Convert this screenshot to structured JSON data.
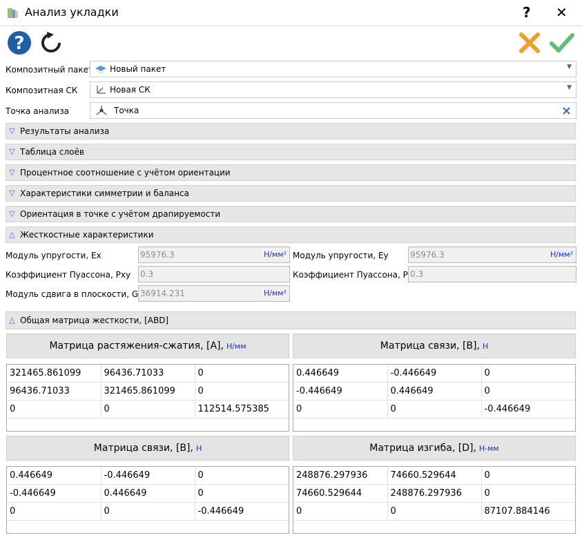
{
  "window": {
    "title": "Анализ укладки",
    "help_glyph": "?",
    "close_glyph": "✕"
  },
  "toolbar": {
    "help_icon": "help-circle-icon",
    "refresh_icon": "refresh-icon",
    "cancel_icon": "cancel-x-icon",
    "ok_icon": "ok-check-icon"
  },
  "colors": {
    "accent_blue": "#1a33c8",
    "help_blue": "#1d5fa8",
    "cancel_orange": "#f0a028",
    "ok_green": "#5fbf70"
  },
  "form": {
    "package": {
      "label": "Композитный пакет",
      "value": "Новый пакет"
    },
    "cs": {
      "label": "Композитная СК",
      "value": "Новая СК"
    },
    "point": {
      "label": "Точка анализа",
      "value": "Точка"
    }
  },
  "sections": [
    {
      "label": "Результаты анализа",
      "expanded": false
    },
    {
      "label": "Таблица слоёв",
      "expanded": false
    },
    {
      "label": "Процентное соотношение с учётом ориентации",
      "expanded": false
    },
    {
      "label": "Характеристики симметрии и баланса",
      "expanded": false
    },
    {
      "label": "Ориентация в точке с учётом драпируемости",
      "expanded": false
    },
    {
      "label": "Жесткостные характеристики",
      "expanded": true
    }
  ],
  "stiffness": {
    "ex": {
      "label": "Модуль упругости, Ex",
      "value": "95976.3",
      "unit": "Н/мм²"
    },
    "ey": {
      "label": "Модуль упругости, Ey",
      "value": "95976.3",
      "unit": "Н/мм²"
    },
    "pxy": {
      "label": "Коэффициент Пуассона, Pxy",
      "value": "0.3"
    },
    "pyx": {
      "label": "Коэффициент Пуассона, Pyx",
      "value": "0.3"
    },
    "gxy": {
      "label": "Модуль сдвига в плоскости, Gxy",
      "value": "36914.231",
      "unit": "Н/мм²"
    }
  },
  "abd_section": {
    "label": "Общая матрица жесткости, [ABD]",
    "expanded": true
  },
  "matrices": {
    "a": {
      "title": "Матрица растяжения-сжатия, [A],",
      "unit": "Н/мм",
      "rows": [
        [
          "321465.861099",
          "96436.71033",
          "0"
        ],
        [
          "96436.71033",
          "321465.861099",
          "0"
        ],
        [
          "0",
          "0",
          "112514.575385"
        ]
      ]
    },
    "b1": {
      "title": "Матрица связи, [B],",
      "unit": "Н",
      "rows": [
        [
          "0.446649",
          "-0.446649",
          "0"
        ],
        [
          "-0.446649",
          "0.446649",
          "0"
        ],
        [
          "0",
          "0",
          "-0.446649"
        ]
      ]
    },
    "b2": {
      "title": "Матрица связи, [B],",
      "unit": "Н",
      "rows": [
        [
          "0.446649",
          "-0.446649",
          "0"
        ],
        [
          "-0.446649",
          "0.446649",
          "0"
        ],
        [
          "0",
          "0",
          "-0.446649"
        ]
      ]
    },
    "d": {
      "title": "Матрица изгиба, [D],",
      "unit": "Н-мм",
      "rows": [
        [
          "248876.297936",
          "74660.529644",
          "0"
        ],
        [
          "74660.529644",
          "248876.297936",
          "0"
        ],
        [
          "0",
          "0",
          "87107.884146"
        ]
      ]
    }
  }
}
